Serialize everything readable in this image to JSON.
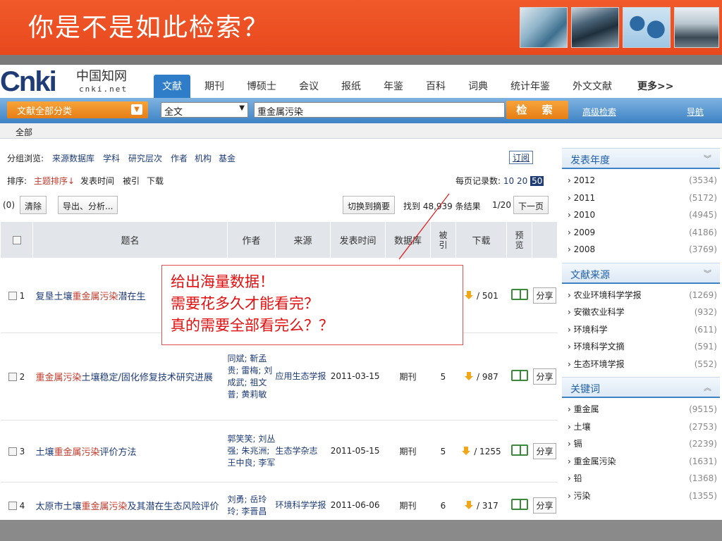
{
  "slide": {
    "title": "你是不是如此检索？"
  },
  "logo": {
    "mark": "Cnki",
    "chinese": "中国知网",
    "domain": "cnki.net"
  },
  "nav_tabs": [
    "文献",
    "期刊",
    "博硕士",
    "会议",
    "报纸",
    "年鉴",
    "百科",
    "词典",
    "统计年鉴",
    "外文文献",
    "更多>>"
  ],
  "search": {
    "category": "文献全部分类",
    "field": "全文",
    "query": "重金属污染",
    "button": "检 索",
    "advanced": "高级检索",
    "nav": "导航"
  },
  "scope": "全部",
  "group_browse": {
    "label": "分组浏览:",
    "items": [
      "来源数据库",
      "学科",
      "研究层次",
      "作者",
      "机构",
      "基金"
    ],
    "subscribe": "订阅"
  },
  "sort": {
    "label": "排序:",
    "items": [
      "主题排序↓",
      "发表时间",
      "被引",
      "下载"
    ]
  },
  "per_page": {
    "label": "每页记录数:",
    "options": [
      "10",
      "20",
      "50"
    ],
    "selected": "50"
  },
  "actions": {
    "selected_count": "(0)",
    "clear": "清除",
    "export": "导出、分析...",
    "switch": "切换到摘要",
    "found": "找到 48,939 条结果",
    "page": "1/20",
    "next": "下一页"
  },
  "table": {
    "headers": [
      "题名",
      "作者",
      "来源",
      "发表时间",
      "数据库",
      "被引",
      "下载",
      "预览"
    ],
    "rows": [
      {
        "num": "1",
        "title_pre": "复垦土壤",
        "title_kw": "重金属污染",
        "title_post": "潜在生",
        "authors": "",
        "source": "",
        "date": "",
        "db": "",
        "cited": "",
        "downloads": "/ 501",
        "share": "分享"
      },
      {
        "num": "2",
        "title_pre": "",
        "title_kw": "重金属污染",
        "title_post": "土壤稳定/固化修复技术研究进展",
        "authors": "同斌; 靳孟贵; 雷梅; 刘成武; 祖文普; 黄莉敏",
        "source": "应用生态学报",
        "date": "2011-03-15",
        "db": "期刊",
        "cited": "5",
        "downloads": "/ 987",
        "share": "分享"
      },
      {
        "num": "3",
        "title_pre": "土壤",
        "title_kw": "重金属污染",
        "title_post": "评价方法",
        "authors": "郭笑笑; 刘丛强; 朱兆洲; 王中良; 李军",
        "source": "生态学杂志",
        "date": "2011-05-15",
        "db": "期刊",
        "cited": "5",
        "downloads": "/ 1255",
        "share": "分享"
      },
      {
        "num": "4",
        "title_pre": "太原市土壤",
        "title_kw": "重金属污染",
        "title_post": "及其潜在生态风险评价",
        "authors": "刘勇; 岳玲玲; 李晋昌",
        "source": "环境科学学报",
        "date": "2011-06-06",
        "db": "期刊",
        "cited": "6",
        "downloads": "/ 317",
        "share": "分享"
      }
    ]
  },
  "sidebar": {
    "sections": [
      {
        "title": "发表年度",
        "items": [
          {
            "label": "2012",
            "count": "(3534)"
          },
          {
            "label": "2011",
            "count": "(5172)"
          },
          {
            "label": "2010",
            "count": "(4945)"
          },
          {
            "label": "2009",
            "count": "(4186)"
          },
          {
            "label": "2008",
            "count": "(3769)"
          }
        ]
      },
      {
        "title": "文献来源",
        "items": [
          {
            "label": "农业环境科学学报",
            "count": "(1269)"
          },
          {
            "label": "安徽农业科学",
            "count": "(932)"
          },
          {
            "label": "环境科学",
            "count": "(611)"
          },
          {
            "label": "环境科学文摘",
            "count": "(591)"
          },
          {
            "label": "生态环境学报",
            "count": "(552)"
          }
        ]
      },
      {
        "title": "关键词",
        "items": [
          {
            "label": "重金属",
            "count": "(9515)"
          },
          {
            "label": "土壤",
            "count": "(2753)"
          },
          {
            "label": "镉",
            "count": "(2239)"
          },
          {
            "label": "重金属污染",
            "count": "(1631)"
          },
          {
            "label": "铅",
            "count": "(1368)"
          },
          {
            "label": "污染",
            "count": "(1355)"
          }
        ]
      }
    ]
  },
  "callout": {
    "lines": [
      "给出海量数据！",
      "需要花多久才能看完？",
      "真的需要全部看完么？？"
    ]
  }
}
